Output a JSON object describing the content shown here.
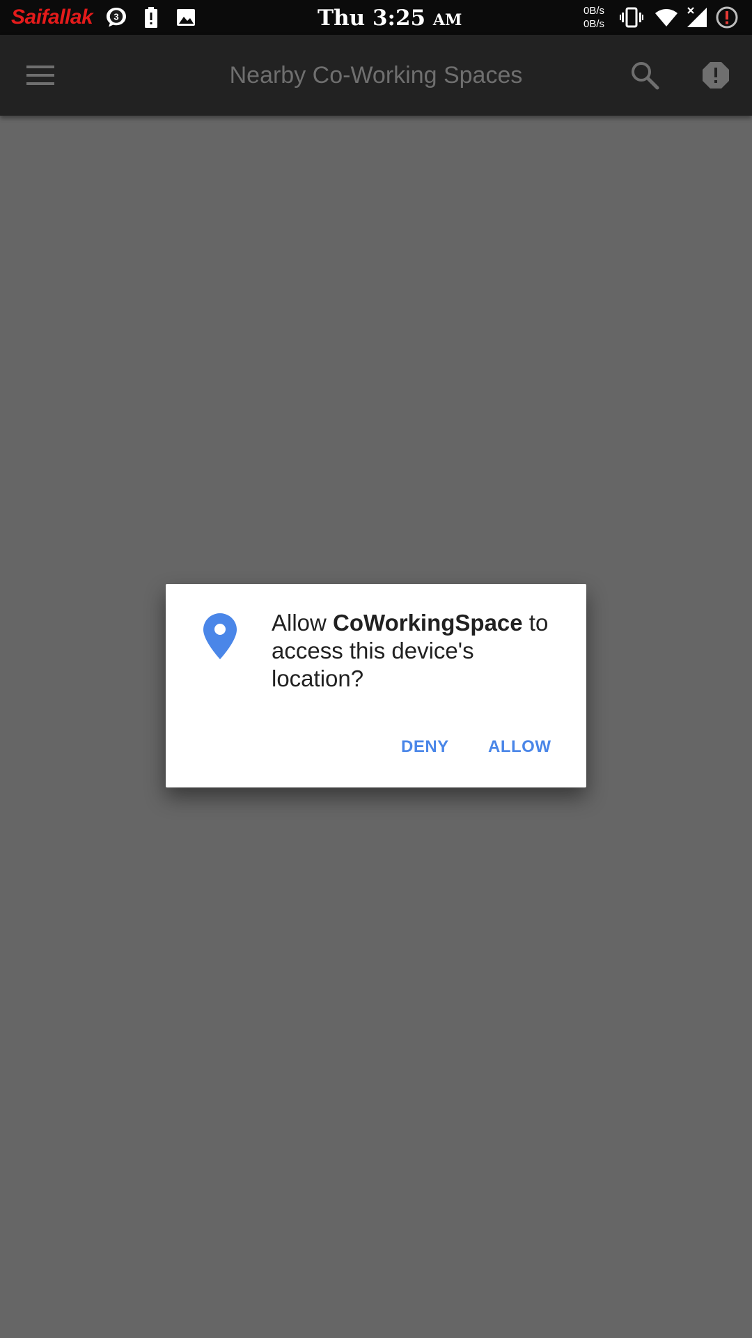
{
  "status_bar": {
    "carrier": "Saifallak",
    "chat_badge_count": "3",
    "clock_time": "Thu 3:25",
    "clock_ampm": "AM",
    "net_up": "0B/s",
    "net_down": "0B/s",
    "icons": [
      "chat-bubble-icon",
      "battery-alert-icon",
      "image-icon",
      "vibrate-icon",
      "wifi-icon",
      "signal-no-data-icon",
      "alert-circle-icon"
    ]
  },
  "app_bar": {
    "title": "Nearby Co-Working Spaces",
    "icons": [
      "menu-icon",
      "search-icon",
      "report-icon"
    ]
  },
  "dialog": {
    "icon": "location-pin-icon",
    "message_prefix": "Allow ",
    "app_name": "CoWorkingSpace",
    "message_suffix": " to access this device's location?",
    "deny_label": "DENY",
    "allow_label": "ALLOW"
  },
  "colors": {
    "accent": "#4a86e8",
    "carrier": "#e31b1b",
    "scrim": "#666666",
    "app_bar": "#222222"
  }
}
